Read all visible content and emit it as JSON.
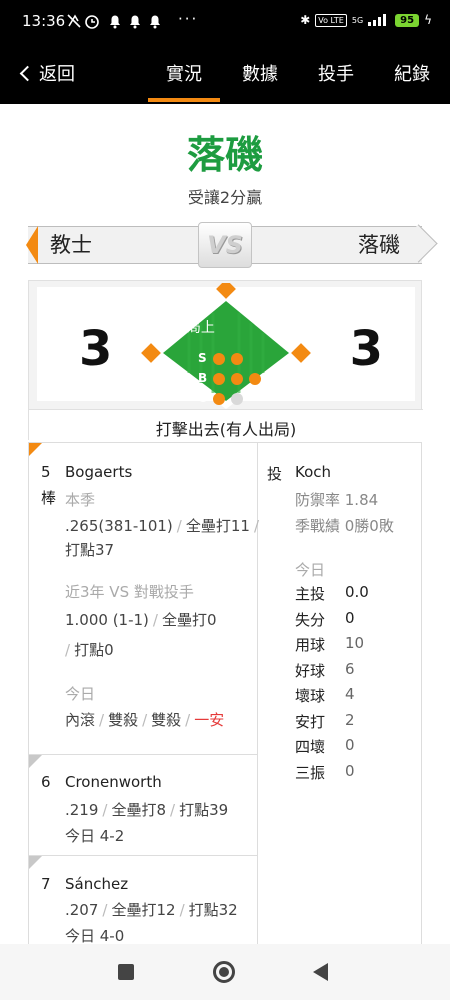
{
  "status_bar": {
    "time": "13:36",
    "left_icons": "⚡⏰🔔🔔🔔 ···",
    "network": "5G",
    "lte": "Vo LTE",
    "battery": "95"
  },
  "nav": {
    "back_label": "返回",
    "tabs": [
      "實況",
      "數據",
      "投手",
      "紀錄"
    ],
    "active_tab": "實況"
  },
  "game": {
    "winner": "落磯",
    "winner_note": "受讓2分贏",
    "away_team": "教士",
    "home_team": "落磯",
    "vs_label": "VS",
    "away_score": "3",
    "home_score": "3",
    "inning": "10局上",
    "sbo_labels": [
      "S",
      "B",
      "O"
    ],
    "strikes": 2,
    "balls": 3,
    "outs": 1,
    "situation": "打擊出去(有人出局)"
  },
  "batters": [
    {
      "order": "5",
      "order_suffix": "棒",
      "name": "Bogaerts",
      "season_label": "本季",
      "season_avg": ".265(381-101)",
      "season_hr": "全壘打11",
      "season_rbi": "打點37",
      "vs_label": "近3年 VS 對戰投手",
      "vs_avg": "1.000 (1-1)",
      "vs_hr": "全壘打0",
      "vs_rbi": "打點0",
      "today_label": "今日",
      "today_results": [
        "內滾",
        "雙殺",
        "雙殺",
        "一安"
      ]
    },
    {
      "order": "6",
      "name": "Cronenworth",
      "avg": ".219",
      "hr": "全壘打8",
      "rbi": "打點39",
      "today": "今日 4-2"
    },
    {
      "order": "7",
      "name": "Sánchez",
      "avg": ".207",
      "hr": "全壘打12",
      "rbi": "打點32",
      "today": "今日 4-0"
    }
  ],
  "pitcher": {
    "role": "投",
    "name": "Koch",
    "era": "防禦率 1.84",
    "record": "季戰績 0勝0敗",
    "today_label": "今日",
    "stats": [
      {
        "label": "主投",
        "value": "0.0"
      },
      {
        "label": "失分",
        "value": "0"
      },
      {
        "label": "用球",
        "value": "10"
      },
      {
        "label": "好球",
        "value": "6"
      },
      {
        "label": "壞球",
        "value": "4"
      },
      {
        "label": "安打",
        "value": "2"
      },
      {
        "label": "四壞",
        "value": "0"
      },
      {
        "label": "三振",
        "value": "0"
      }
    ]
  },
  "colors": {
    "accent": "#f38a12",
    "winner_green": "#1d9c40",
    "field_green": "#2aa53a",
    "hit_red": "#e53a3a"
  }
}
